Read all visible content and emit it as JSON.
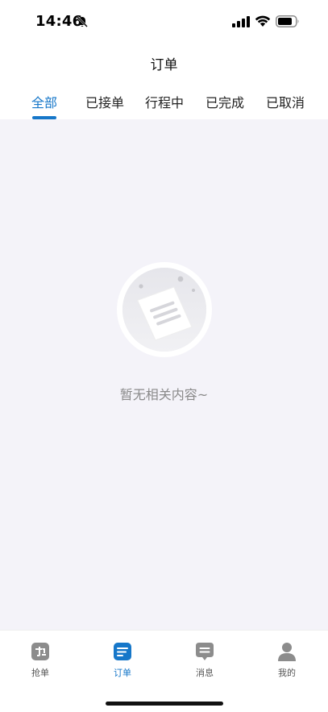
{
  "status_bar": {
    "time": "14:46"
  },
  "header": {
    "title": "订单"
  },
  "tabs": [
    {
      "label": "全部",
      "active": true
    },
    {
      "label": "已接单",
      "active": false
    },
    {
      "label": "行程中",
      "active": false
    },
    {
      "label": "已完成",
      "active": false
    },
    {
      "label": "已取消",
      "active": false
    }
  ],
  "empty_state": {
    "message": "暂无相关内容~"
  },
  "tabbar": [
    {
      "label": "抢单",
      "icon": "grab-order-icon",
      "active": false
    },
    {
      "label": "订单",
      "icon": "order-list-icon",
      "active": true
    },
    {
      "label": "消息",
      "icon": "message-icon",
      "active": false
    },
    {
      "label": "我的",
      "icon": "user-icon",
      "active": false
    }
  ],
  "colors": {
    "accent": "#1677c9",
    "background": "#f4f3f9",
    "inactive_icon": "#8c8c8c"
  }
}
